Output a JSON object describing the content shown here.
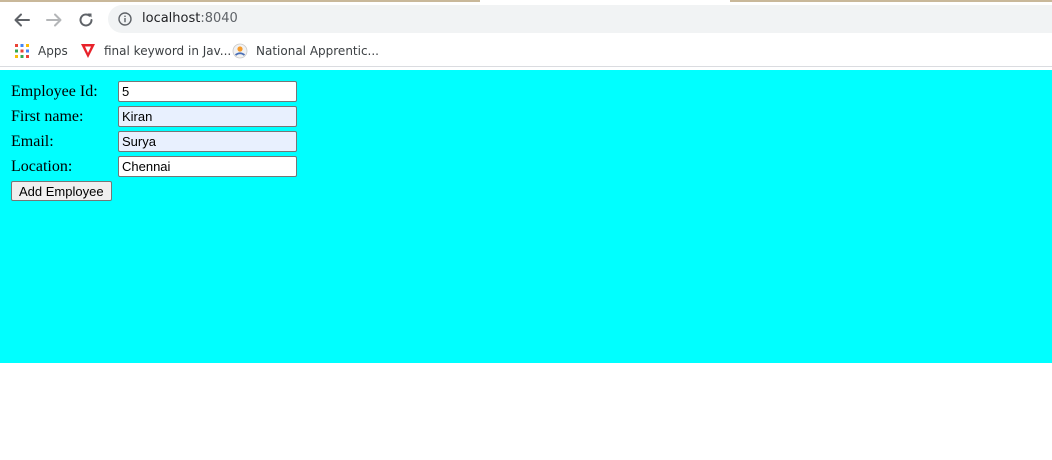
{
  "browser": {
    "url_host": "localhost",
    "url_port": ":8040",
    "bookmarks": [
      {
        "label": "Apps",
        "icon": "apps-grid-icon"
      },
      {
        "label": "final keyword in Jav...",
        "icon": "red-v-logo-icon"
      },
      {
        "label": "National Apprentic...",
        "icon": "apprentice-logo-icon"
      }
    ]
  },
  "form": {
    "fields": [
      {
        "label": "Employee Id:",
        "value": "5"
      },
      {
        "label": "First name:",
        "value": "Kiran"
      },
      {
        "label": "Email:",
        "value": "Surya"
      },
      {
        "label": "Location:",
        "value": "Chennai"
      }
    ],
    "submit_label": "Add Employee"
  },
  "colors": {
    "page_background": "#00ffff",
    "autofill_background": "#e8f0fe"
  }
}
